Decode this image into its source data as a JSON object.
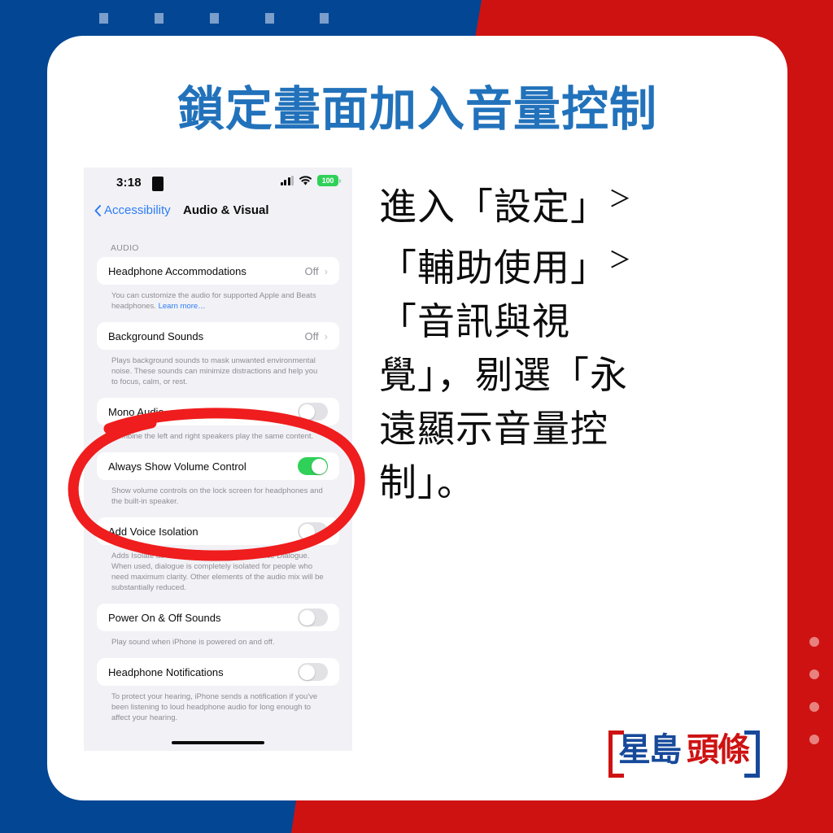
{
  "theme": {
    "blue": "#034694",
    "red": "#ce1212",
    "headline_blue": "#2272bb",
    "toggle_green": "#30d158",
    "annotation_red": "#ef1d1d"
  },
  "headline": "鎖定畫面加入音量控制",
  "instruction": {
    "line1": "進入「設定」",
    "gt1": "＞",
    "line2": "「輔助使用」",
    "gt2": "＞",
    "line3": "「音訊與視",
    "line4": "覺」，剔選「永",
    "line5": "遠顯示音量控",
    "line6": "制」。"
  },
  "phone": {
    "status_bar": {
      "time": "3:18",
      "battery_percent": "100"
    },
    "nav": {
      "back_label": "Accessibility",
      "title": "Audio & Visual"
    },
    "section_header": "AUDIO",
    "rows": [
      {
        "label": "Headphone Accommodations",
        "value": "Off",
        "type": "disclosure",
        "note": "You can customize the audio for supported Apple and Beats headphones. ",
        "note_link": "Learn more…"
      },
      {
        "label": "Background Sounds",
        "value": "Off",
        "type": "disclosure",
        "note": "Plays background sounds to mask unwanted environmental noise. These sounds can minimize distractions and help you to focus, calm, or rest."
      },
      {
        "label": "Mono Audio",
        "type": "toggle",
        "toggle_on": false,
        "note": "Combine the left and right speakers play the same content."
      },
      {
        "label": "Always Show Volume Control",
        "type": "toggle",
        "toggle_on": true,
        "note": "Show volume controls on the lock screen for headphones and the built-in speaker."
      },
      {
        "label": "Add Voice Isolation",
        "type": "toggle",
        "toggle_on": false,
        "note": "Adds Isolate as an additional option to Enhance Dialogue. When used, dialogue is completely isolated for people who need maximum clarity. Other elements of the audio mix will be substantially reduced."
      },
      {
        "label": "Power On & Off Sounds",
        "type": "toggle",
        "toggle_on": false,
        "note": "Play sound when iPhone is powered on and off."
      },
      {
        "label": "Headphone Notifications",
        "type": "toggle",
        "toggle_on": false,
        "note": "To protect your hearing, iPhone sends a notification if you've been listening to loud headphone audio for long enough to affect your hearing."
      }
    ]
  },
  "logo": {
    "blue_text": "星島",
    "red_text": "頭條"
  }
}
